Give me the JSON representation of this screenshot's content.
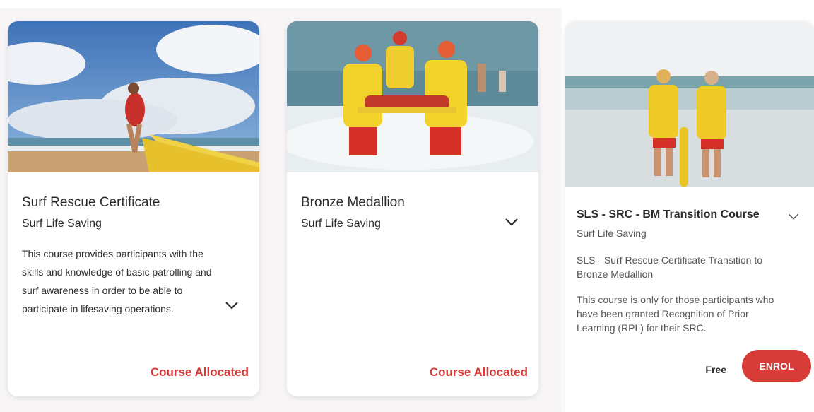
{
  "cards": [
    {
      "title": "Surf Rescue Certificate",
      "organisation": "Surf Life Saving",
      "description": "This course provides participants with the skills and knowledge of basic patrolling and surf awareness in order to be able to participate in lifesaving operations.",
      "status": "Course Allocated",
      "image_icon": "beach-runner-with-rescue-board-image",
      "expand_icon": "chevron-down-icon"
    },
    {
      "title": "Bronze Medallion",
      "organisation": "Surf Life Saving",
      "status": "Course Allocated",
      "image_icon": "lifesavers-carrying-patient-image",
      "expand_icon": "chevron-down-icon"
    },
    {
      "title": "SLS - SRC - BM Transition Course",
      "organisation": "Surf Life Saving",
      "subtitle": "SLS - Surf Rescue Certificate Transition to Bronze Medallion",
      "description": "This course is only for those participants who have been granted Recognition of Prior Learning (RPL) for their SRC.",
      "price": "Free",
      "enrol_label": "ENROL",
      "image_icon": "two-lifesavers-watching-sea-image",
      "expand_icon": "chevron-down-icon"
    }
  ],
  "colors": {
    "accent": "#d73a37",
    "button": "#d83c39",
    "text": "#2b2b2b",
    "panel_background": "#f7f5f6"
  }
}
